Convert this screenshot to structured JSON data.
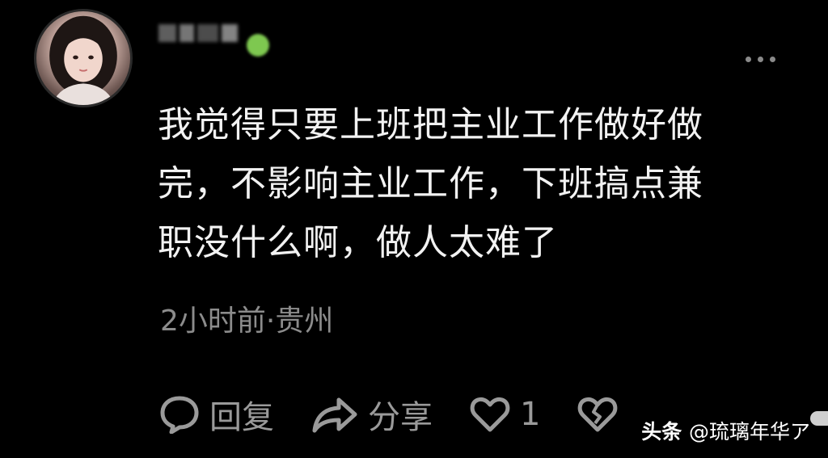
{
  "comment": {
    "user": {
      "name_blurred": true,
      "avatar": "avatar-image"
    },
    "lines": [
      "我觉得只要上班把主业工作做好做",
      "完，不影响主业工作，下班搞点兼",
      "职没什么啊，做人太难了"
    ],
    "meta": "2小时前·贵州"
  },
  "actions": {
    "reply_icon": "comment-bubble-icon",
    "reply_label": "回复",
    "share_icon": "share-arrow-icon",
    "share_label": "分享",
    "like_icon": "heart-icon",
    "like_count": "1",
    "dislike_icon": "broken-heart-icon"
  },
  "more_icon": "more-dots-icon",
  "watermark": {
    "brand": "头条",
    "handle": "@琉璃年华ア"
  },
  "colors": {
    "background": "#000000",
    "text": "#f2f2f2",
    "meta": "#8c8c8c",
    "action": "#9a9a9a"
  }
}
